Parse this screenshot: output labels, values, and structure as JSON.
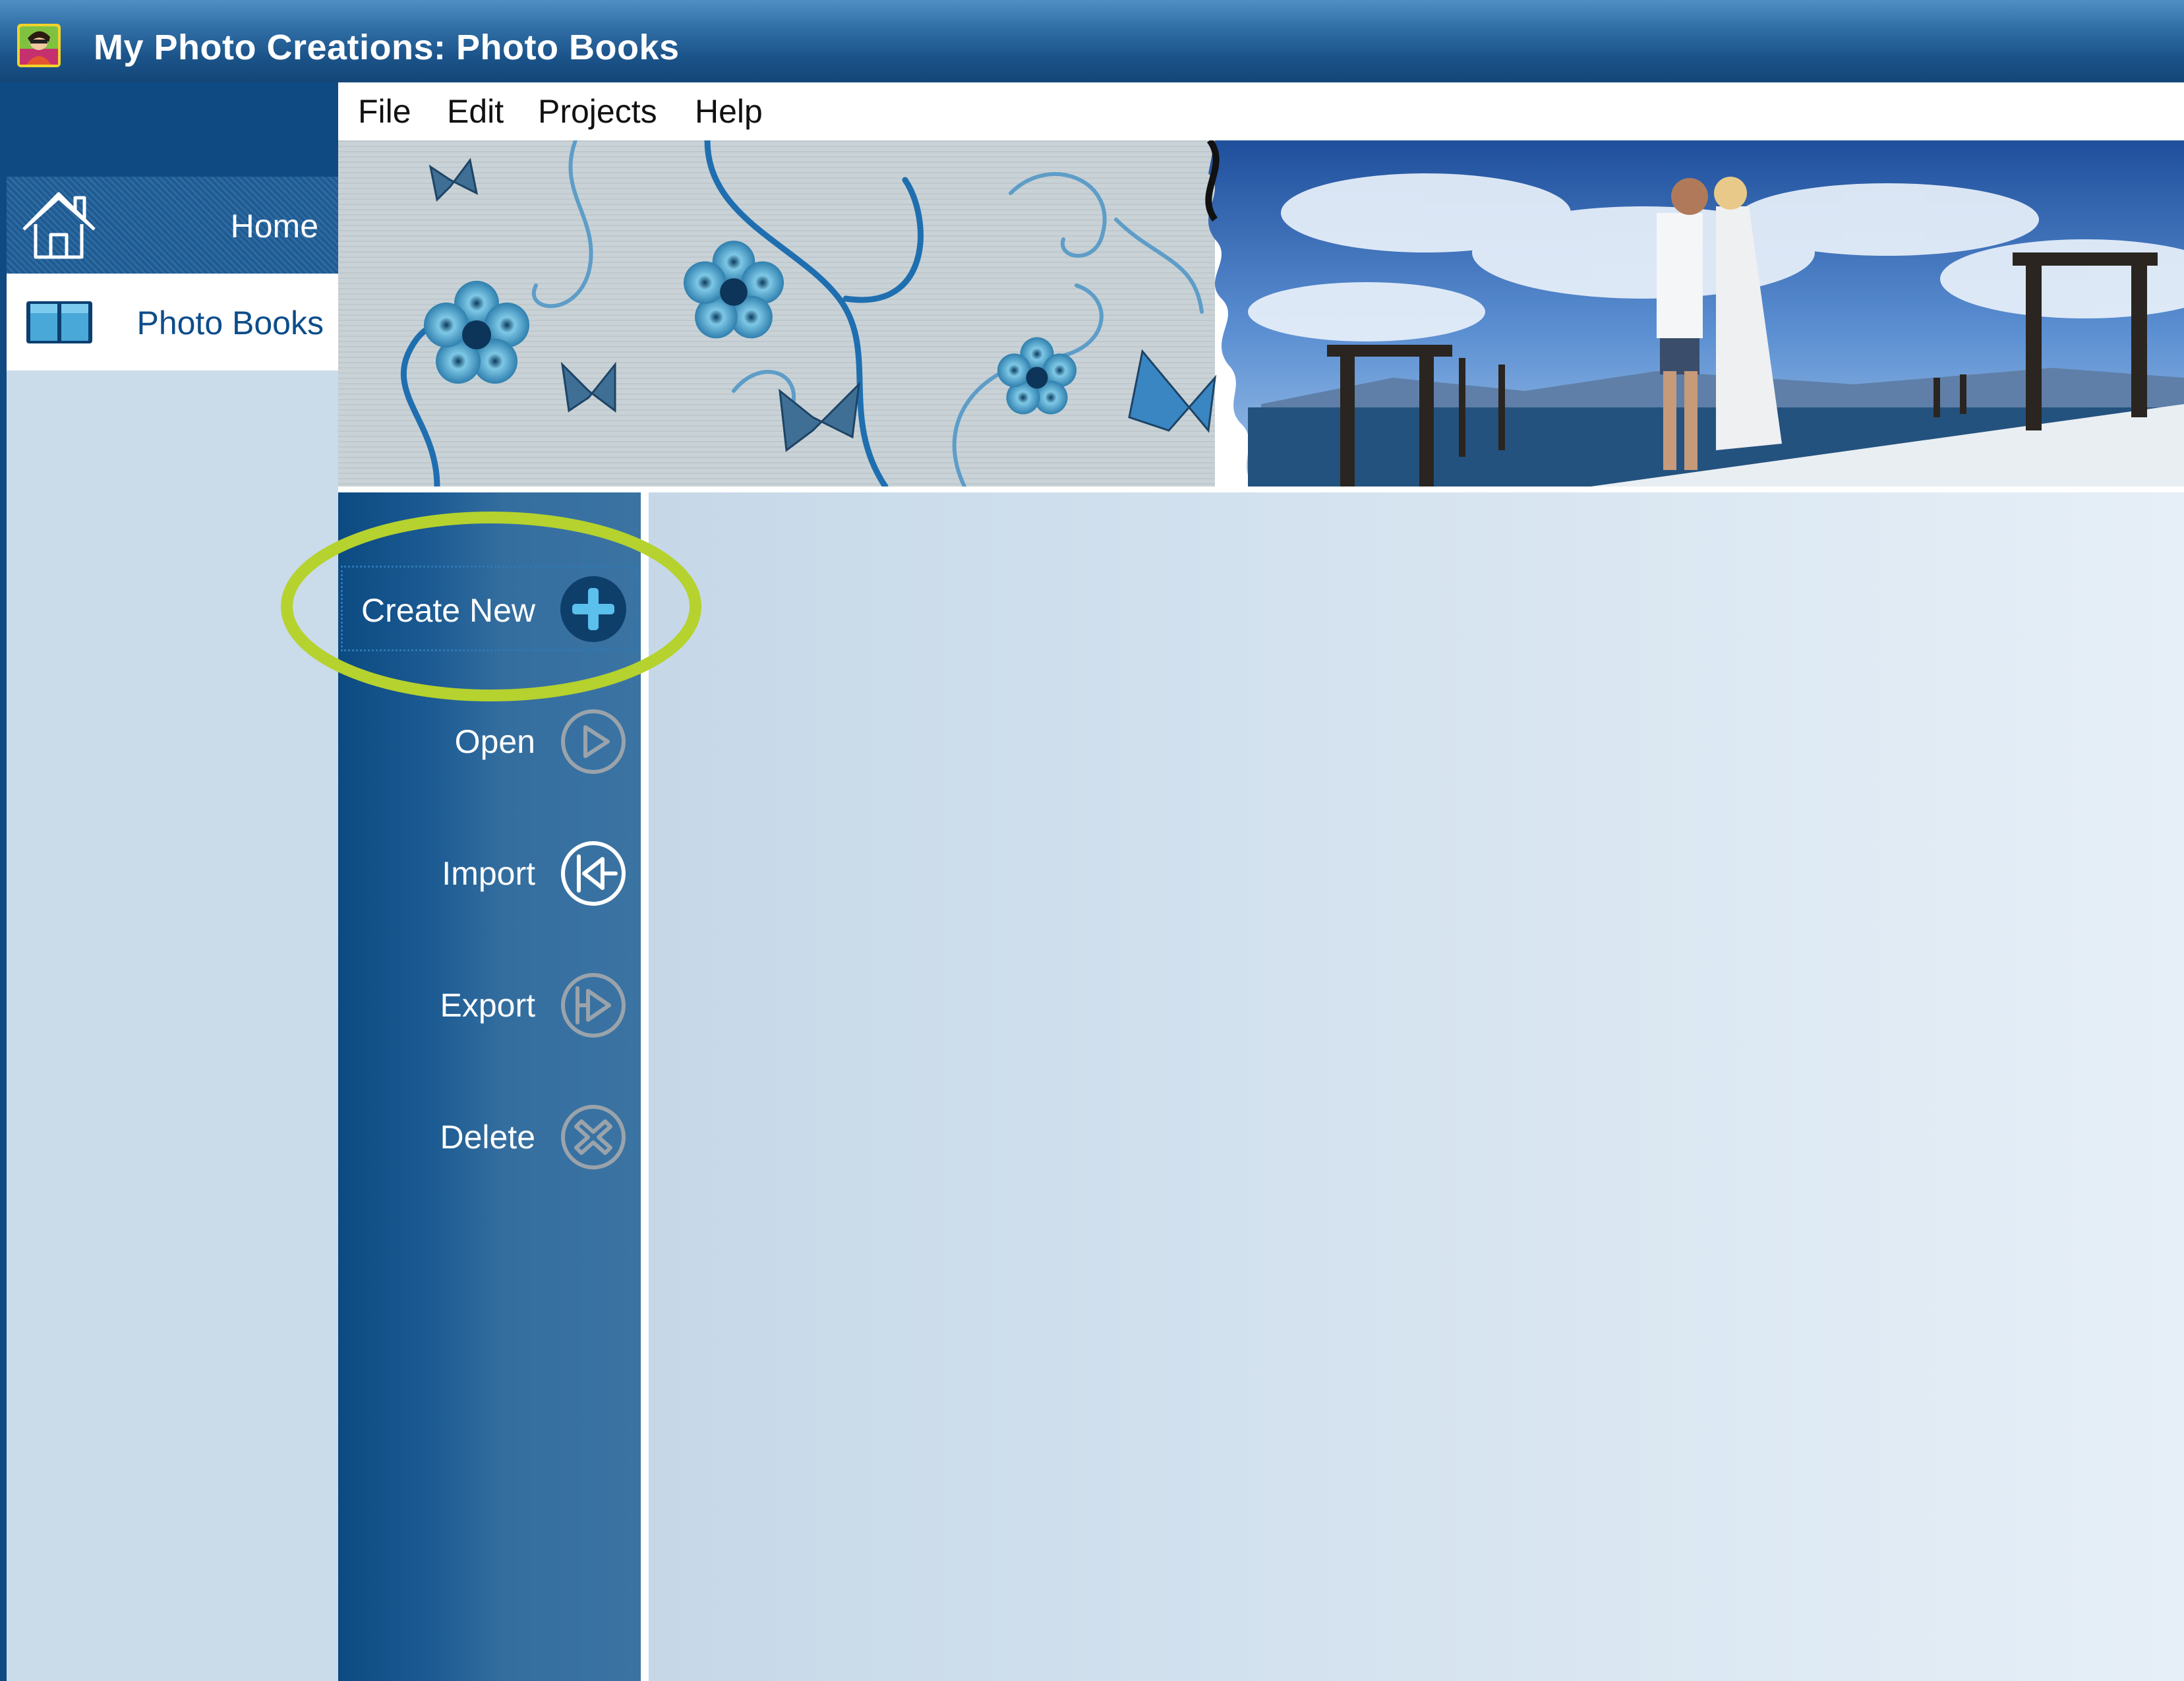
{
  "window": {
    "title": "My Photo Creations: Photo Books"
  },
  "menu": {
    "items": [
      "File",
      "Edit",
      "Projects",
      "Help"
    ]
  },
  "nav": {
    "items": [
      {
        "label": "Home",
        "icon": "home-icon",
        "active": false
      },
      {
        "label": "Photo Books",
        "icon": "photo-book-icon",
        "active": true
      }
    ]
  },
  "actions": [
    {
      "label": "Create New",
      "icon": "plus-icon",
      "highlighted": true
    },
    {
      "label": "Open",
      "icon": "play-icon"
    },
    {
      "label": "Import",
      "icon": "import-icon"
    },
    {
      "label": "Export",
      "icon": "export-icon"
    },
    {
      "label": "Delete",
      "icon": "delete-icon"
    }
  ],
  "colors": {
    "title_bar": "#1b5389",
    "sidebar_navy": "#0f4a83",
    "action_column": "#2a6498",
    "highlight_ring": "#b5d22e",
    "active_nav_text": "#0d4d8a",
    "main_background": "#d6e4f0"
  }
}
